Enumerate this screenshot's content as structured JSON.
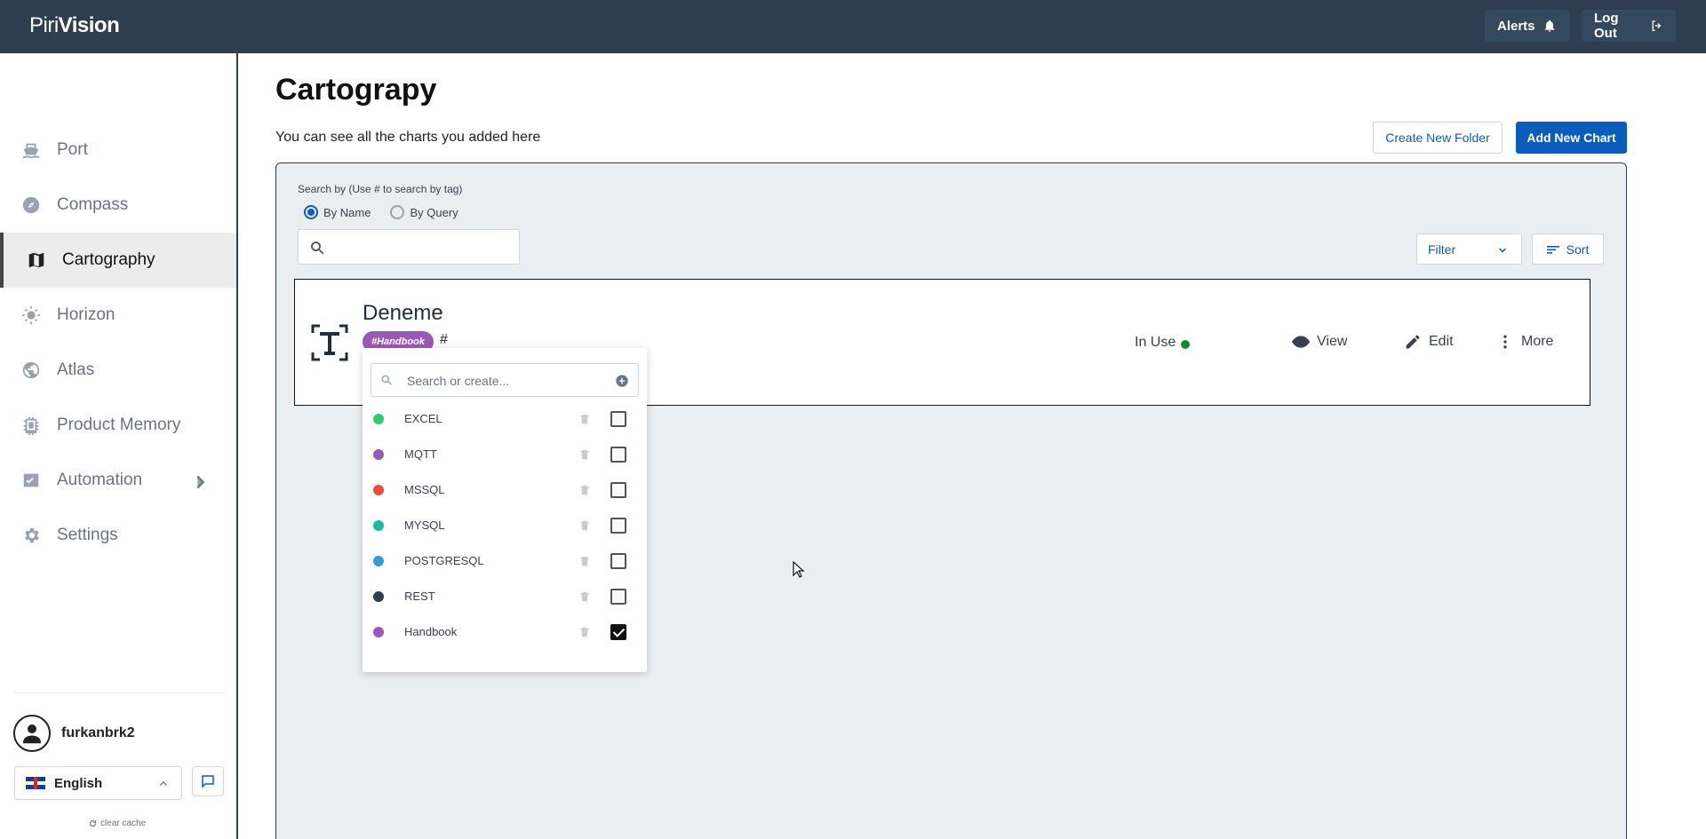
{
  "header": {
    "logo_prefix": "Piri",
    "logo_bold": "Vision",
    "alerts_label": "Alerts",
    "logout_label": "Log Out"
  },
  "sidebar": {
    "items": [
      {
        "label": "Port",
        "icon": "ship-icon"
      },
      {
        "label": "Compass",
        "icon": "compass-icon"
      },
      {
        "label": "Cartography",
        "icon": "map-icon",
        "active": true
      },
      {
        "label": "Horizon",
        "icon": "sun-icon"
      },
      {
        "label": "Atlas",
        "icon": "globe-icon"
      },
      {
        "label": "Product Memory",
        "icon": "chip-icon"
      },
      {
        "label": "Automation",
        "icon": "automation-icon",
        "has_submenu": true
      },
      {
        "label": "Settings",
        "icon": "gear-icon"
      }
    ],
    "username": "furkanbrk2",
    "language": "English",
    "clear_cache": "clear cache"
  },
  "main": {
    "title": "Cartograpy",
    "subtitle": "You can see all the charts you added here",
    "create_folder_label": "Create New Folder",
    "add_chart_label": "Add New Chart",
    "search_label": "Search by  (Use # to search by tag)",
    "radio_by_name": "By Name",
    "radio_by_query": "By Query",
    "selected_radio": "By Name",
    "filter_label": "Filter",
    "sort_label": "Sort"
  },
  "card": {
    "title": "Deneme",
    "tag": "#Handbook",
    "tag_color": "#9b59b6",
    "hash": "#",
    "status": "In Use",
    "status_color": "#138a2d",
    "view_label": "View",
    "edit_label": "Edit",
    "more_label": "More"
  },
  "tag_popup": {
    "search_placeholder": "Search or create...",
    "tags": [
      {
        "name": "EXCEL",
        "color": "#2ecc71",
        "checked": false
      },
      {
        "name": "MQTT",
        "color": "#9b59b6",
        "checked": false
      },
      {
        "name": "MSSQL",
        "color": "#e74c3c",
        "checked": false
      },
      {
        "name": "MYSQL",
        "color": "#1abc9c",
        "checked": false
      },
      {
        "name": "POSTGRESQL",
        "color": "#3498db",
        "checked": false
      },
      {
        "name": "REST",
        "color": "#2c3e50",
        "checked": false
      },
      {
        "name": "Handbook",
        "color": "#9b59b6",
        "checked": true
      }
    ]
  }
}
